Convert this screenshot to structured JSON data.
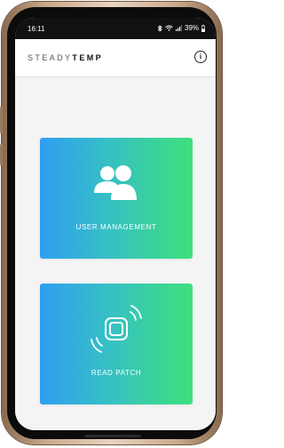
{
  "status_bar": {
    "time": "16:11",
    "battery": "39%",
    "icons": [
      "bluetooth-icon",
      "wifi-icon",
      "signal-icon",
      "battery-icon"
    ]
  },
  "app_bar": {
    "brand_light": "STEADY",
    "brand_bold": "TEMP",
    "info_icon": "info-icon",
    "info_glyph": "i"
  },
  "cards": {
    "user_management": {
      "label": "USER MANAGEMENT",
      "icon": "users-icon"
    },
    "read_patch": {
      "label": "READ PATCH",
      "icon": "nfc-patch-icon"
    }
  },
  "colors": {
    "gradient_start": "#2f9ef2",
    "gradient_end": "#3ee07c",
    "status_bar": "#111111",
    "app_background": "#f4f4f4"
  }
}
